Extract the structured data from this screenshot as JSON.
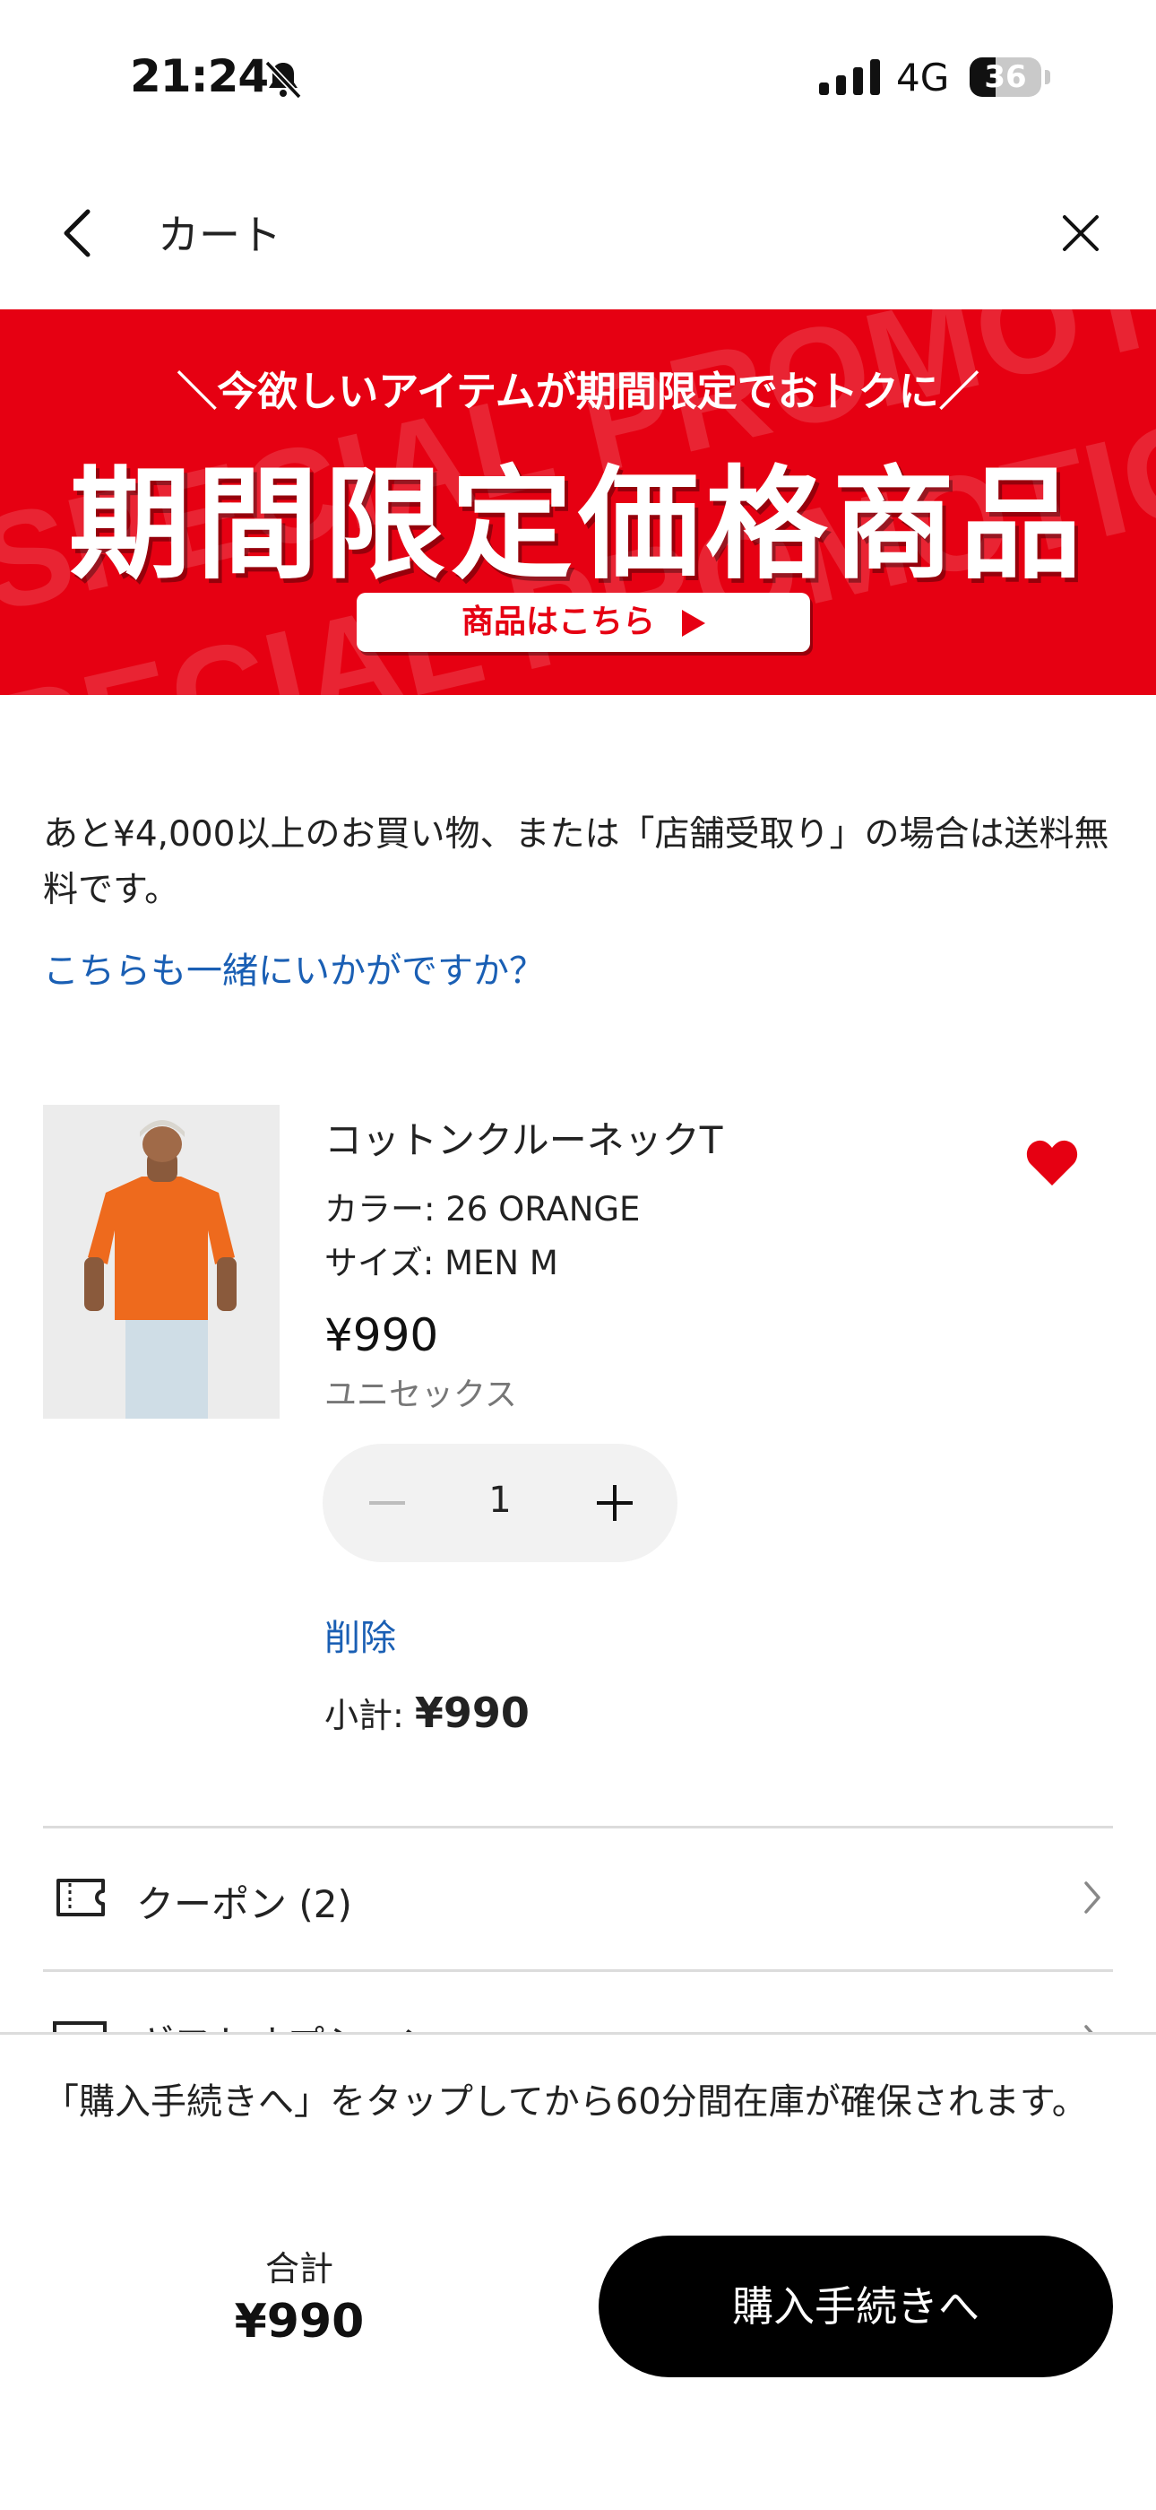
{
  "status_bar": {
    "time": "21:24",
    "network": "4G",
    "battery": "36",
    "battery_level": 0.36
  },
  "nav": {
    "title": "カート"
  },
  "banner": {
    "background_text": "SPECIAL PROMOTION",
    "subtitle": "＼今欲しいアイテムが期間限定でおトクに／",
    "title": "期間限定価格商品",
    "button_label": "商品はこちら",
    "color": "#e60012"
  },
  "info": {
    "shipping_notice": "あと¥4,000以上のお買い物、または「店舗受取り」の場合は送料無料です。",
    "suggestion_link": "こちらも一緒にいかがですか？"
  },
  "product": {
    "name": "コットンクルーネックT",
    "color": "カラー: 26 ORANGE",
    "size": "サイズ: MEN M",
    "price": "¥990",
    "gender": "ユニセックス",
    "quantity": "1",
    "delete_label": "削除",
    "subtotal_label": "小計:",
    "subtotal_value": "¥990",
    "favorite": true,
    "heart_color": "#e60012"
  },
  "options": {
    "coupon_label": "クーポン (2)",
    "gift_label": "ギフトオプション"
  },
  "footer": {
    "notice": "「購入手続きへ」をタップしてから60分間在庫が確保されます。",
    "total_label": "合計",
    "total_value": "¥990",
    "checkout_label": "購入手続きへ"
  }
}
